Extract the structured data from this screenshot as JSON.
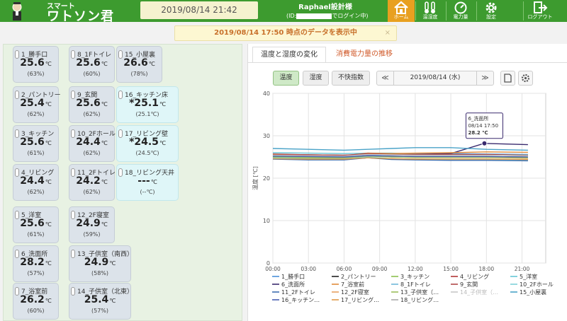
{
  "header": {
    "logo_sub": "スマート",
    "logo_main": "ワトソン君",
    "datetime": "2019/08/14 21:42",
    "company": "Raphael設計様",
    "login_prefix": "(ID:",
    "login_suffix": "でログイン中)",
    "nav": [
      {
        "label": "ホーム"
      },
      {
        "label": "温湿度"
      },
      {
        "label": "電力量"
      },
      {
        "label": "設定"
      },
      {
        "label": "ログアウト"
      }
    ],
    "colors": {
      "header": "#3d9b2f",
      "active_nav": "#e8a020"
    }
  },
  "notice": {
    "text": "2019/08/14 17:50 時点のデータを表示中",
    "close": "×"
  },
  "sensors": [
    {
      "name": "1_勝手口",
      "temp": "25.6",
      "unit": "℃",
      "hum": "(63%)",
      "color": "gray"
    },
    {
      "name": "8_1Fトイレ",
      "temp": "25.6",
      "unit": "℃",
      "hum": "(60%)",
      "color": "gray"
    },
    {
      "name": "15_小屋裏",
      "temp": "26.6",
      "unit": "℃",
      "hum": "(78%)",
      "color": "gray"
    },
    {
      "name": "2_パントリー",
      "temp": "25.4",
      "unit": "℃",
      "hum": "(62%)",
      "color": "gray"
    },
    {
      "name": "9_玄関",
      "temp": "25.6",
      "unit": "℃",
      "hum": "(62%)",
      "color": "gray"
    },
    {
      "name": "16_キッチン床",
      "temp": "*25.1",
      "unit": "℃",
      "hum": "(25.1℃)",
      "color": "cyan"
    },
    {
      "name": "3_キッチン",
      "temp": "25.6",
      "unit": "℃",
      "hum": "(61%)",
      "color": "gray"
    },
    {
      "name": "10_2Fホール",
      "temp": "24.4",
      "unit": "℃",
      "hum": "(62%)",
      "color": "gray"
    },
    {
      "name": "17_リビング壁",
      "temp": "*24.5",
      "unit": "℃",
      "hum": "(24.5℃)",
      "color": "cyan"
    },
    {
      "name": "4_リビング",
      "temp": "24.4",
      "unit": "℃",
      "hum": "(62%)",
      "color": "gray"
    },
    {
      "name": "11_2Fトイレ",
      "temp": "24.2",
      "unit": "℃",
      "hum": "(62%)",
      "color": "gray"
    },
    {
      "name": "18_リビング天井",
      "temp": "---",
      "unit": "℃",
      "hum": "(--℃)",
      "color": "cyan"
    },
    {
      "name": "5_洋室",
      "temp": "25.6",
      "unit": "℃",
      "hum": "(61%)",
      "color": "gray"
    },
    {
      "name": "12_2F寝室",
      "temp": "24.9",
      "unit": "℃",
      "hum": "(59%)",
      "color": "gray"
    },
    {
      "name": "6_洗面所",
      "temp": "28.2",
      "unit": "℃",
      "hum": "(57%)",
      "color": "gray"
    },
    {
      "name": "13_子供室（南西）",
      "temp": "24.9",
      "unit": "℃",
      "hum": "(58%)",
      "color": "gray"
    },
    {
      "name": "7_浴室前",
      "temp": "26.2",
      "unit": "℃",
      "hum": "(60%)",
      "color": "gray"
    },
    {
      "name": "14_子供室（北東）",
      "temp": "25.4",
      "unit": "℃",
      "hum": "(57%)",
      "color": "gray"
    }
  ],
  "tabs": {
    "temp_hum": "温度と湿度の変化",
    "power": "消費電力量の推移"
  },
  "controls": {
    "temp": "温度",
    "hum": "湿度",
    "discomfort": "不快指数",
    "prev": "≪",
    "next": "≫",
    "date": "2019/08/14 (水)"
  },
  "chart_data": {
    "type": "line",
    "ylabel": "温度 [℃]",
    "ylim": [
      0,
      40
    ],
    "yticks": [
      0,
      10,
      20,
      30,
      40
    ],
    "xticks": [
      "00:00",
      "03:00",
      "06:00",
      "09:00",
      "12:00",
      "15:00",
      "18:00",
      "21:00"
    ],
    "xlim": [
      0,
      23
    ],
    "grid": true,
    "legend_position": "bottom",
    "tooltip": {
      "series": "6_洗面所",
      "time": "08/14 17:50",
      "value": "28.2 ℃",
      "x": 17.83,
      "y": 28.2
    },
    "series": [
      {
        "name": "1_勝手口",
        "color": "#4a90d9",
        "y": [
          25.4,
          25.3,
          25.2,
          25.3,
          25.6,
          25.7,
          25.8,
          25.7,
          25.6
        ],
        "x": [
          0,
          3,
          6,
          8,
          10,
          12,
          15,
          18,
          21.5
        ]
      },
      {
        "name": "2_パントリー",
        "color": "#222222",
        "y": [
          25.6,
          25.5,
          25.4,
          25.6,
          25.5,
          25.4,
          25.4,
          25.4,
          25.3
        ],
        "x": [
          0,
          3,
          6,
          8,
          10,
          12,
          15,
          18,
          21.5
        ]
      },
      {
        "name": "3_キッチン",
        "color": "#8cbf4e",
        "y": [
          24.8,
          24.7,
          24.8,
          25.9,
          25.7,
          25.5,
          25.5,
          25.6,
          25.3
        ],
        "x": [
          0,
          3,
          6,
          8,
          10,
          12,
          15,
          18,
          21.5
        ]
      },
      {
        "name": "4_リビング",
        "color": "#b03535",
        "y": [
          24.6,
          24.5,
          24.5,
          24.8,
          24.6,
          24.4,
          24.4,
          24.4,
          24.3
        ],
        "x": [
          0,
          3,
          6,
          8,
          10,
          12,
          15,
          18,
          21.5
        ]
      },
      {
        "name": "5_洋室",
        "color": "#66c6d6",
        "y": [
          26.0,
          25.9,
          25.8,
          25.9,
          25.9,
          25.7,
          25.6,
          25.6,
          25.5
        ],
        "x": [
          0,
          3,
          6,
          8,
          10,
          12,
          15,
          18,
          21.5
        ]
      },
      {
        "name": "6_洗面所",
        "color": "#3a2a6e",
        "y": [
          25.2,
          25.0,
          24.9,
          25.6,
          25.5,
          25.6,
          25.8,
          28.2,
          27.9
        ],
        "x": [
          0,
          3,
          6,
          8,
          10,
          12,
          15,
          17.8,
          21.5
        ]
      },
      {
        "name": "7_浴室前",
        "color": "#e08a3a",
        "y": [
          25.6,
          25.4,
          25.3,
          25.9,
          25.8,
          25.9,
          26.0,
          26.2,
          26.1
        ],
        "x": [
          0,
          3,
          6,
          8,
          10,
          12,
          15,
          18,
          21.5
        ]
      },
      {
        "name": "8_1Fトイレ",
        "color": "#6fb8d8",
        "y": [
          25.3,
          25.2,
          25.1,
          25.6,
          25.5,
          25.5,
          25.5,
          25.6,
          25.4
        ],
        "x": [
          0,
          3,
          6,
          8,
          10,
          12,
          15,
          18,
          21.5
        ]
      },
      {
        "name": "9_玄関",
        "color": "#b04848",
        "y": [
          25.7,
          25.5,
          25.4,
          25.8,
          25.6,
          25.6,
          25.6,
          25.6,
          25.4
        ],
        "x": [
          0,
          3,
          6,
          8,
          10,
          12,
          15,
          18,
          21.5
        ]
      },
      {
        "name": "10_2Fホール",
        "color": "#7fd0d8",
        "y": [
          24.8,
          24.6,
          24.6,
          25.0,
          24.6,
          24.5,
          24.4,
          24.4,
          24.3
        ],
        "x": [
          0,
          3,
          6,
          8,
          10,
          12,
          15,
          18,
          21.5
        ]
      },
      {
        "name": "11_2Fトイレ",
        "color": "#3d6eb0",
        "y": [
          24.5,
          24.3,
          24.3,
          24.8,
          24.4,
          24.3,
          24.2,
          24.2,
          24.1
        ],
        "x": [
          0,
          3,
          6,
          8,
          10,
          12,
          15,
          18,
          21.5
        ]
      },
      {
        "name": "12_2F寝室",
        "color": "#e8a060",
        "y": [
          25.1,
          24.9,
          24.9,
          25.3,
          25.0,
          24.9,
          24.9,
          24.9,
          24.7
        ],
        "x": [
          0,
          3,
          6,
          8,
          10,
          12,
          15,
          18,
          21.5
        ]
      },
      {
        "name": "13_子供室（…",
        "color": "#9bbd5a",
        "y": [
          25.0,
          24.9,
          24.8,
          25.2,
          25.0,
          24.9,
          24.9,
          24.9,
          24.8
        ],
        "x": [
          0,
          3,
          6,
          8,
          10,
          12,
          15,
          18,
          21.5
        ]
      },
      {
        "name": "14_子供室（…",
        "color": "#c8c8c8",
        "y": [
          25.4,
          25.3,
          25.2,
          25.6,
          25.5,
          25.4,
          25.4,
          25.4,
          25.3
        ],
        "x": [
          0,
          3,
          6,
          8,
          10,
          12,
          15,
          18,
          21.5
        ]
      },
      {
        "name": "15_小屋裏",
        "color": "#4aa3c8",
        "y": [
          27.0,
          26.8,
          26.6,
          26.8,
          27.0,
          27.2,
          27.2,
          26.8,
          26.6
        ],
        "x": [
          0,
          3,
          6,
          8,
          10,
          12,
          15,
          18,
          21.5
        ]
      },
      {
        "name": "16_キッチン…",
        "color": "#4a5fb0",
        "y": [
          25.2,
          25.1,
          25.0,
          25.3,
          25.2,
          25.1,
          25.1,
          25.1,
          25.0
        ],
        "x": [
          0,
          3,
          6,
          8,
          10,
          12,
          15,
          18,
          21.5
        ]
      },
      {
        "name": "17_リビング…",
        "color": "#e09a4a",
        "y": [
          24.6,
          24.5,
          24.5,
          24.8,
          24.6,
          24.5,
          24.5,
          24.5,
          24.4
        ],
        "x": [
          0,
          3,
          6,
          8,
          10,
          12,
          15,
          18,
          21.5
        ]
      },
      {
        "name": "18_リビング…",
        "color": "#a8a8a8",
        "y": [],
        "x": []
      }
    ],
    "legend_disabled": [
      "14_子供室（…"
    ]
  }
}
